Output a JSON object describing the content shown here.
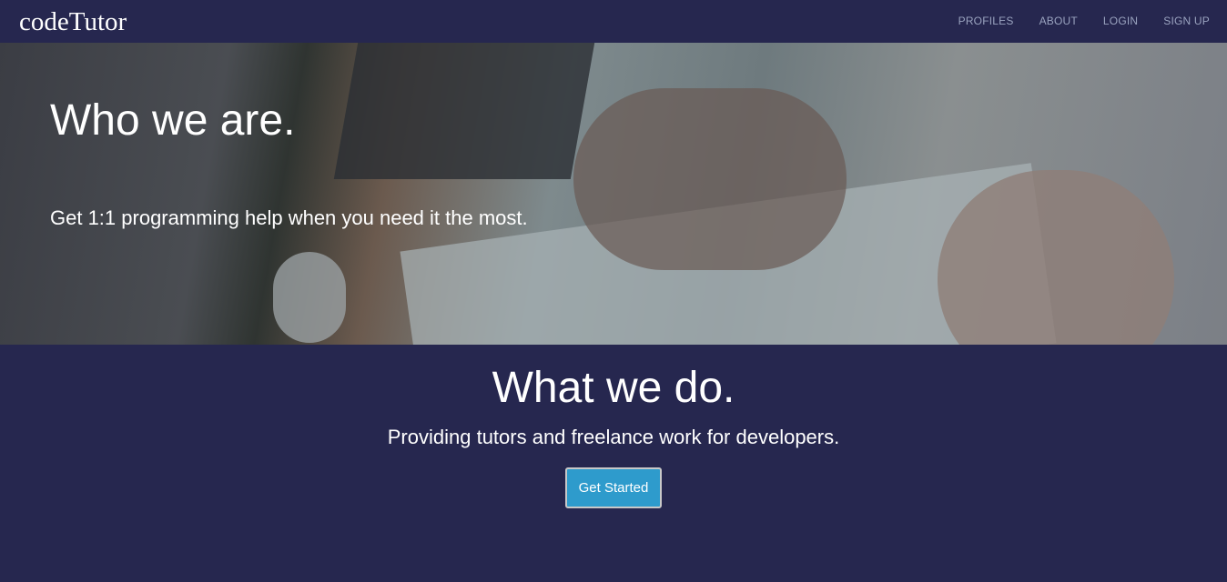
{
  "nav": {
    "logo": "codeTutor",
    "links": [
      "PROFILES",
      "ABOUT",
      "LOGIN",
      "SIGN UP"
    ]
  },
  "hero": {
    "title": "Who we are.",
    "subtitle": "Get 1:1 programming help when you need it the most."
  },
  "what": {
    "title": "What we do.",
    "subtitle": "Providing tutors and freelance work for developers.",
    "button": "Get Started"
  },
  "colors": {
    "background": "#26274f",
    "button": "#2e9bcc",
    "nav_link": "#9aa3bf"
  }
}
